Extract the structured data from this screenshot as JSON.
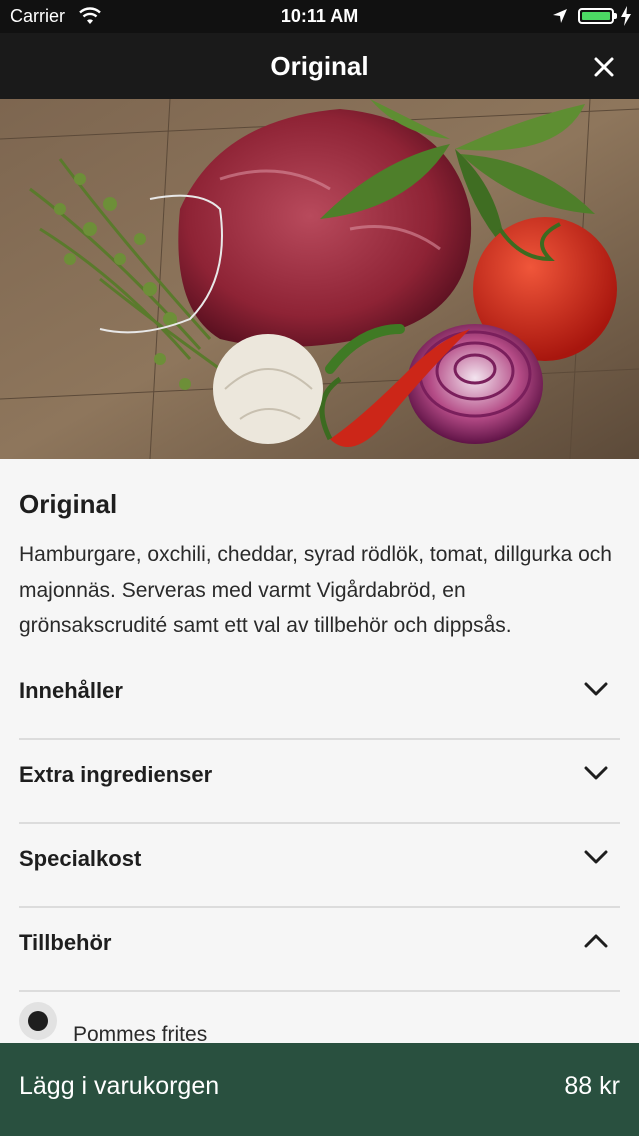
{
  "status_bar": {
    "carrier": "Carrier",
    "time": "10:11 AM",
    "battery_color": "#4cd964"
  },
  "navbar": {
    "title": "Original",
    "close_icon": "close-icon"
  },
  "hero_image": {
    "description_icon": "photo-meat-vegetables"
  },
  "dish": {
    "title": "Original",
    "description": "Hamburgare, oxchili, cheddar, syrad rödlök, tomat, dillgurka och majonnäs. Serveras med varmt Vigårdabröd, en grönsakscrudité samt ett val av tillbehör och dippsås."
  },
  "sections": [
    {
      "label": "Innehåller",
      "expanded": false
    },
    {
      "label": "Extra ingredienser",
      "expanded": false
    },
    {
      "label": "Specialkost",
      "expanded": false
    },
    {
      "label": "Tillbehör",
      "expanded": true
    }
  ],
  "accessory_options": [
    {
      "label": "Pommes frites",
      "selected": true
    }
  ],
  "cart": {
    "label": "Lägg i varukorgen",
    "price": "88 kr",
    "color": "#29503f"
  }
}
